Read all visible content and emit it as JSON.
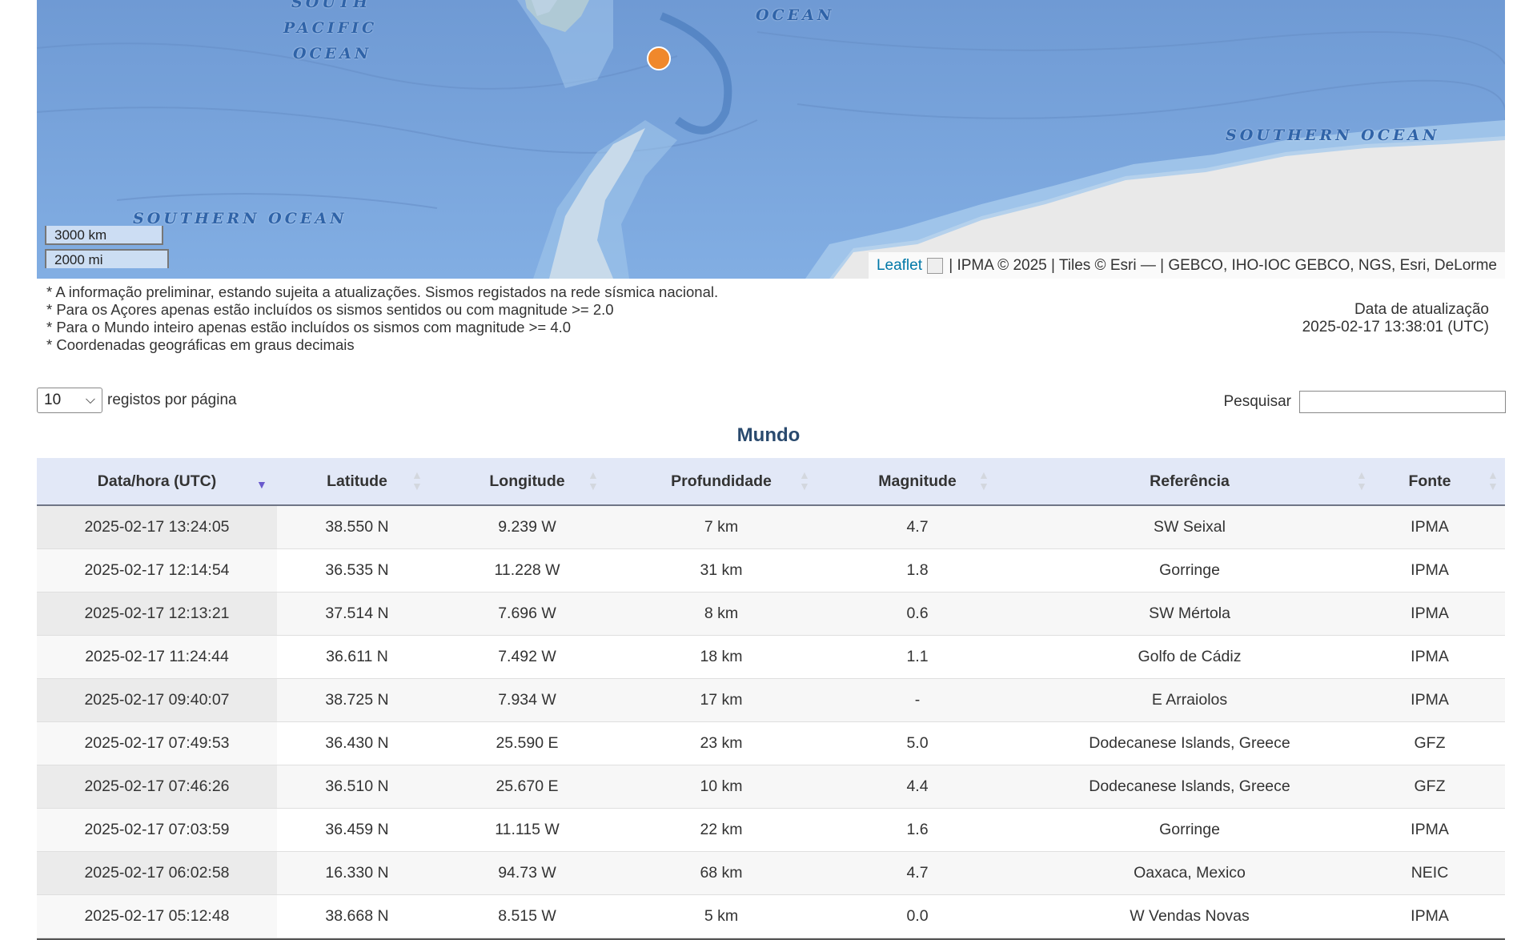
{
  "map": {
    "ocean_labels": [
      "SOUTH",
      "PACIFIC",
      "OCEAN",
      "OCEAN",
      "SOUTHERN OCEAN",
      "SOUTHERN OCEAN"
    ],
    "scale_km": "3000 km",
    "scale_mi": "2000 mi",
    "attribution_link": "Leaflet",
    "attribution_rest": " | IPMA © 2025 | Tiles © Esri — | GEBCO, IHO-IOC GEBCO, NGS, Esri, DeLorme",
    "marker_color": "#f0882b"
  },
  "notes": [
    "* A informação preliminar, estando sujeita a atualizações. Sismos registados na rede sísmica nacional.",
    "* Para os Açores apenas estão incluídos os sismos sentidos ou com magnitude >= 2.0",
    "* Para o Mundo inteiro apenas estão incluídos os sismos com magnitude >= 4.0",
    "* Coordenadas geográficas em graus decimais"
  ],
  "update": {
    "label": "Data de atualização",
    "value": "2025-02-17 13:38:01 (UTC)"
  },
  "controls": {
    "page_size": "10",
    "page_size_label": "registos por página",
    "search_label": "Pesquisar",
    "search_value": ""
  },
  "table": {
    "title": "Mundo",
    "columns": [
      "Data/hora (UTC)",
      "Latitude",
      "Longitude",
      "Profundidade",
      "Magnitude",
      "Referência",
      "Fonte"
    ],
    "rows": [
      [
        "2025-02-17 13:24:05",
        "38.550 N",
        "9.239 W",
        "7 km",
        "4.7",
        "SW Seixal",
        "IPMA"
      ],
      [
        "2025-02-17 12:14:54",
        "36.535 N",
        "11.228 W",
        "31 km",
        "1.8",
        "Gorringe",
        "IPMA"
      ],
      [
        "2025-02-17 12:13:21",
        "37.514 N",
        "7.696 W",
        "8 km",
        "0.6",
        "SW Mértola",
        "IPMA"
      ],
      [
        "2025-02-17 11:24:44",
        "36.611 N",
        "7.492 W",
        "18 km",
        "1.1",
        "Golfo de Cádiz",
        "IPMA"
      ],
      [
        "2025-02-17 09:40:07",
        "38.725 N",
        "7.934 W",
        "17 km",
        "-",
        "E Arraiolos",
        "IPMA"
      ],
      [
        "2025-02-17 07:49:53",
        "36.430 N",
        "25.590 E",
        "23 km",
        "5.0",
        "Dodecanese Islands, Greece",
        "GFZ"
      ],
      [
        "2025-02-17 07:46:26",
        "36.510 N",
        "25.670 E",
        "10 km",
        "4.4",
        "Dodecanese Islands, Greece",
        "GFZ"
      ],
      [
        "2025-02-17 07:03:59",
        "36.459 N",
        "11.115 W",
        "22 km",
        "1.6",
        "Gorringe",
        "IPMA"
      ],
      [
        "2025-02-17 06:02:58",
        "16.330 N",
        "94.73 W",
        "68 km",
        "4.7",
        "Oaxaca, Mexico",
        "NEIC"
      ],
      [
        "2025-02-17 05:12:48",
        "38.668 N",
        "8.515 W",
        "5 km",
        "0.0",
        "W Vendas Novas",
        "IPMA"
      ]
    ]
  }
}
